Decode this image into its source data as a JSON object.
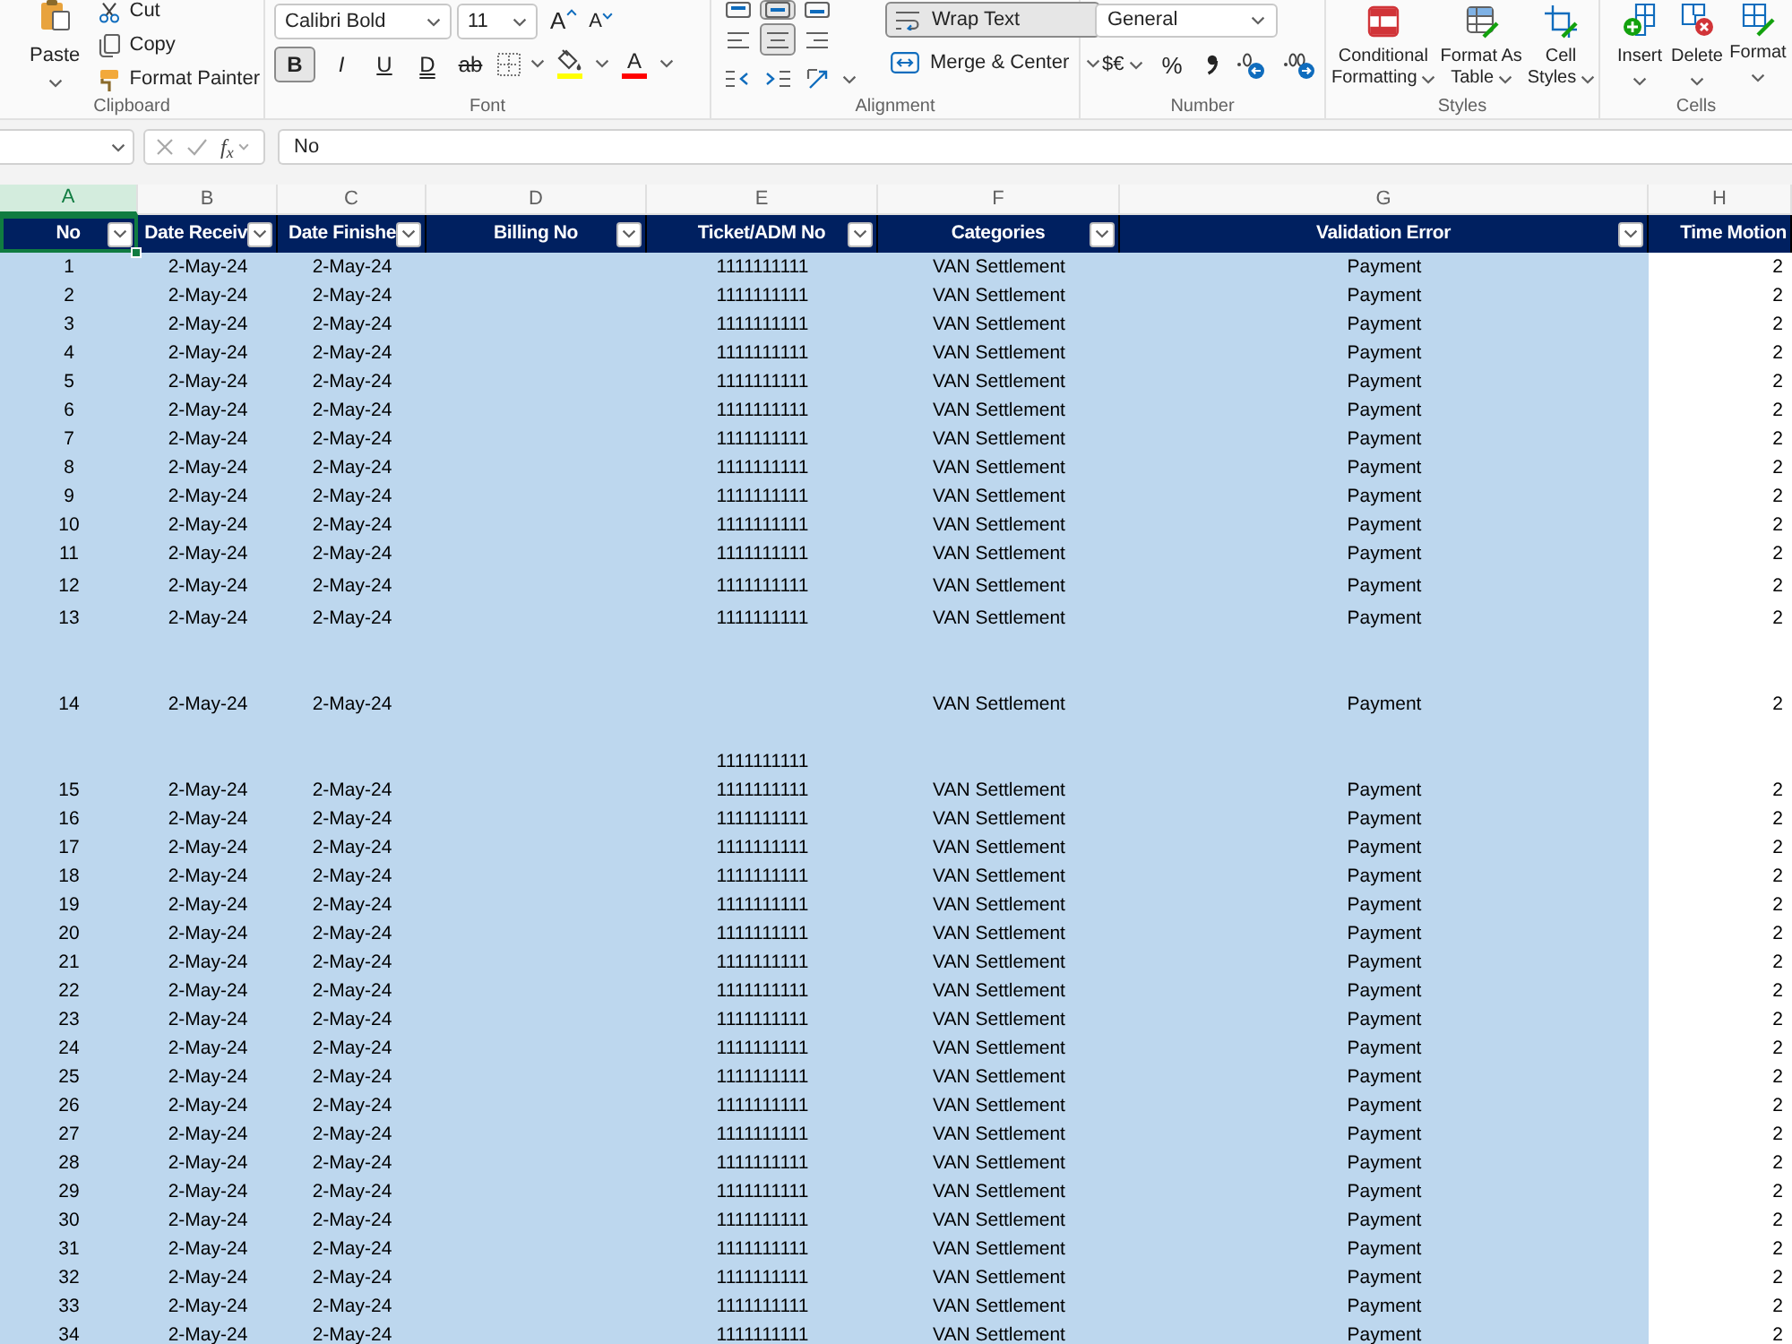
{
  "ribbon": {
    "clipboard": {
      "label": "Clipboard",
      "paste": "Paste",
      "items": [
        {
          "kind": "cut",
          "label": "Cut"
        },
        {
          "kind": "copy",
          "label": "Copy"
        },
        {
          "kind": "format_painter",
          "label": "Format Painter"
        }
      ]
    },
    "font": {
      "label": "Font",
      "font_name": "Calibri Bold",
      "font_size": "11",
      "size_buttons": [
        {
          "kind": "grow",
          "glyph": "A"
        },
        {
          "kind": "shrink",
          "glyph": "A"
        }
      ],
      "style_buttons": [
        {
          "kind": "bold",
          "glyph": "B",
          "selected": true
        },
        {
          "kind": "italic",
          "glyph": "I",
          "selected": false
        },
        {
          "kind": "underline",
          "glyph": "U",
          "selected": false
        },
        {
          "kind": "double_underline",
          "glyph": "D",
          "selected": false
        },
        {
          "kind": "strikethrough",
          "glyph": "ab",
          "selected": false
        }
      ],
      "color_buttons": [
        {
          "kind": "borders"
        },
        {
          "kind": "fill_color",
          "color": "#ffff00"
        },
        {
          "kind": "font_color",
          "glyph": "A",
          "color": "#ff0000"
        }
      ]
    },
    "alignment": {
      "label": "Alignment",
      "buttons": [
        [
          {
            "kind": "top",
            "selected": false
          },
          {
            "kind": "middle",
            "selected": true
          },
          {
            "kind": "bottom",
            "selected": false
          }
        ],
        [
          {
            "kind": "left",
            "selected": false
          },
          {
            "kind": "center",
            "selected": true
          },
          {
            "kind": "right",
            "selected": false
          }
        ],
        [
          {
            "kind": "indent_less",
            "selected": false
          },
          {
            "kind": "indent_more",
            "selected": false
          },
          {
            "kind": "orientation",
            "selected": false
          }
        ]
      ],
      "wrap_text": {
        "label": "Wrap Text",
        "selected": true
      },
      "merge": {
        "label": "Merge & Center"
      }
    },
    "number": {
      "label": "Number",
      "format": "General",
      "currency": "$€",
      "percent": "%",
      "buttons": [
        {
          "kind": "comma"
        },
        {
          "kind": "increase_decimal"
        },
        {
          "kind": "decrease_decimal"
        }
      ]
    },
    "styles": {
      "label": "Styles",
      "items": [
        {
          "kind": "conditional",
          "lines": [
            "Conditional",
            "Formatting"
          ]
        },
        {
          "kind": "table",
          "lines": [
            "Format As",
            "Table"
          ]
        },
        {
          "kind": "cell_styles",
          "lines": [
            "Cell",
            "Styles"
          ]
        }
      ]
    },
    "cells": {
      "label": "Cells",
      "items": [
        {
          "kind": "insert",
          "label": "Insert"
        },
        {
          "kind": "delete",
          "label": "Delete"
        },
        {
          "kind": "format",
          "label": "Format"
        }
      ]
    }
  },
  "formula_bar": {
    "function_glyph": "f$_{x}$",
    "formula": "No"
  },
  "sheet": {
    "columns": [
      {
        "letter": "A",
        "selected": true
      },
      {
        "letter": "B",
        "selected": false
      },
      {
        "letter": "C",
        "selected": false
      },
      {
        "letter": "D",
        "selected": false
      },
      {
        "letter": "E",
        "selected": false
      },
      {
        "letter": "F",
        "selected": false
      },
      {
        "letter": "G",
        "selected": false
      },
      {
        "letter": "H",
        "selected": false
      }
    ],
    "header": [
      {
        "label": "No",
        "selected": true,
        "filter": true
      },
      {
        "label": "Date Receiv",
        "selected": false,
        "filter": true
      },
      {
        "label": "Date Finishe",
        "selected": false,
        "filter": true
      },
      {
        "label": "Billing No",
        "selected": false,
        "filter": true
      },
      {
        "label": "Ticket/ADM No",
        "selected": false,
        "filter": true
      },
      {
        "label": "Categories",
        "selected": false,
        "filter": true
      },
      {
        "label": "Validation Error",
        "selected": false,
        "filter": true
      },
      {
        "label": "Time Motion",
        "selected": false,
        "filter": false
      }
    ],
    "rows": [
      {
        "A": "1",
        "B": "2-May-24",
        "C": "2-May-24",
        "E": "1111111111",
        "F": "VAN Settlement",
        "G": "Payment",
        "H": "2"
      },
      {
        "A": "2",
        "B": "2-May-24",
        "C": "2-May-24",
        "E": "1111111111",
        "F": "VAN Settlement",
        "G": "Payment",
        "H": "2"
      },
      {
        "A": "3",
        "B": "2-May-24",
        "C": "2-May-24",
        "E": "1111111111",
        "F": "VAN Settlement",
        "G": "Payment",
        "H": "2"
      },
      {
        "A": "4",
        "B": "2-May-24",
        "C": "2-May-24",
        "E": "1111111111",
        "F": "VAN Settlement",
        "G": "Payment",
        "H": "2"
      },
      {
        "A": "5",
        "B": "2-May-24",
        "C": "2-May-24",
        "E": "1111111111",
        "F": "VAN Settlement",
        "G": "Payment",
        "H": "2"
      },
      {
        "A": "6",
        "B": "2-May-24",
        "C": "2-May-24",
        "E": "1111111111",
        "F": "VAN Settlement",
        "G": "Payment",
        "H": "2"
      },
      {
        "A": "7",
        "B": "2-May-24",
        "C": "2-May-24",
        "E": "1111111111",
        "F": "VAN Settlement",
        "G": "Payment",
        "H": "2"
      },
      {
        "A": "8",
        "B": "2-May-24",
        "C": "2-May-24",
        "E": "1111111111",
        "F": "VAN Settlement",
        "G": "Payment",
        "H": "2"
      },
      {
        "A": "9",
        "B": "2-May-24",
        "C": "2-May-24",
        "E": "1111111111",
        "F": "VAN Settlement",
        "G": "Payment",
        "H": "2"
      },
      {
        "A": "10",
        "B": "2-May-24",
        "C": "2-May-24",
        "E": "1111111111",
        "F": "VAN Settlement",
        "G": "Payment",
        "H": "2"
      },
      {
        "A": "11",
        "B": "2-May-24",
        "C": "2-May-24",
        "E": "1111111111",
        "F": "VAN Settlement",
        "G": "Payment",
        "H": "2"
      },
      {
        "A": "12",
        "B": "2-May-24",
        "C": "2-May-24",
        "E": "1111111111",
        "F": "VAN Settlement",
        "G": "Payment",
        "H": "2"
      },
      {
        "A": "13",
        "B": "2-May-24",
        "C": "2-May-24",
        "E": "1111111111",
        "F": "VAN Settlement",
        "G": "Payment",
        "H": "2"
      },
      {
        "A": "14",
        "B": "2-May-24",
        "C": "2-May-24",
        "F": "VAN Settlement",
        "G": "Payment",
        "H": "2"
      },
      {
        "A": "15",
        "B": "2-May-24",
        "C": "2-May-24",
        "E": "1111111111\n1111111111",
        "F": "VAN Settlement",
        "G": "Payment",
        "H": "2"
      },
      {
        "A": "16",
        "B": "2-May-24",
        "C": "2-May-24",
        "E": "1111111111",
        "F": "VAN Settlement",
        "G": "Payment",
        "H": "2"
      },
      {
        "A": "17",
        "B": "2-May-24",
        "C": "2-May-24",
        "E": "1111111111",
        "F": "VAN Settlement",
        "G": "Payment",
        "H": "2"
      },
      {
        "A": "18",
        "B": "2-May-24",
        "C": "2-May-24",
        "E": "1111111111",
        "F": "VAN Settlement",
        "G": "Payment",
        "H": "2"
      },
      {
        "A": "19",
        "B": "2-May-24",
        "C": "2-May-24",
        "E": "1111111111",
        "F": "VAN Settlement",
        "G": "Payment",
        "H": "2"
      },
      {
        "A": "20",
        "B": "2-May-24",
        "C": "2-May-24",
        "E": "1111111111",
        "F": "VAN Settlement",
        "G": "Payment",
        "H": "2"
      },
      {
        "A": "21",
        "B": "2-May-24",
        "C": "2-May-24",
        "E": "1111111111",
        "F": "VAN Settlement",
        "G": "Payment",
        "H": "2"
      },
      {
        "A": "22",
        "B": "2-May-24",
        "C": "2-May-24",
        "E": "1111111111",
        "F": "VAN Settlement",
        "G": "Payment",
        "H": "2"
      },
      {
        "A": "23",
        "B": "2-May-24",
        "C": "2-May-24",
        "E": "1111111111",
        "F": "VAN Settlement",
        "G": "Payment",
        "H": "2"
      },
      {
        "A": "24",
        "B": "2-May-24",
        "C": "2-May-24",
        "E": "1111111111",
        "F": "VAN Settlement",
        "G": "Payment",
        "H": "2"
      },
      {
        "A": "25",
        "B": "2-May-24",
        "C": "2-May-24",
        "E": "1111111111",
        "F": "VAN Settlement",
        "G": "Payment",
        "H": "2"
      },
      {
        "A": "26",
        "B": "2-May-24",
        "C": "2-May-24",
        "E": "1111111111",
        "F": "VAN Settlement",
        "G": "Payment",
        "H": "2"
      },
      {
        "A": "27",
        "B": "2-May-24",
        "C": "2-May-24",
        "E": "1111111111",
        "F": "VAN Settlement",
        "G": "Payment",
        "H": "2"
      },
      {
        "A": "28",
        "B": "2-May-24",
        "C": "2-May-24",
        "E": "1111111111",
        "F": "VAN Settlement",
        "G": "Payment",
        "H": "2"
      },
      {
        "A": "29",
        "B": "2-May-24",
        "C": "2-May-24",
        "E": "1111111111",
        "F": "VAN Settlement",
        "G": "Payment",
        "H": "2"
      },
      {
        "A": "30",
        "B": "2-May-24",
        "C": "2-May-24",
        "E": "1111111111",
        "F": "VAN Settlement",
        "G": "Payment",
        "H": "2"
      },
      {
        "A": "31",
        "B": "2-May-24",
        "C": "2-May-24",
        "E": "1111111111",
        "F": "VAN Settlement",
        "G": "Payment",
        "H": "2"
      },
      {
        "A": "32",
        "B": "2-May-24",
        "C": "2-May-24",
        "E": "1111111111",
        "F": "VAN Settlement",
        "G": "Payment",
        "H": "2"
      },
      {
        "A": "33",
        "B": "2-May-24",
        "C": "2-May-24",
        "E": "1111111111",
        "F": "VAN Settlement",
        "G": "Payment",
        "H": "2"
      },
      {
        "A": "34",
        "B": "2-May-24",
        "C": "2-May-24",
        "E": "1111111111",
        "F": "VAN Settlement",
        "G": "Payment",
        "H": "2"
      }
    ]
  }
}
